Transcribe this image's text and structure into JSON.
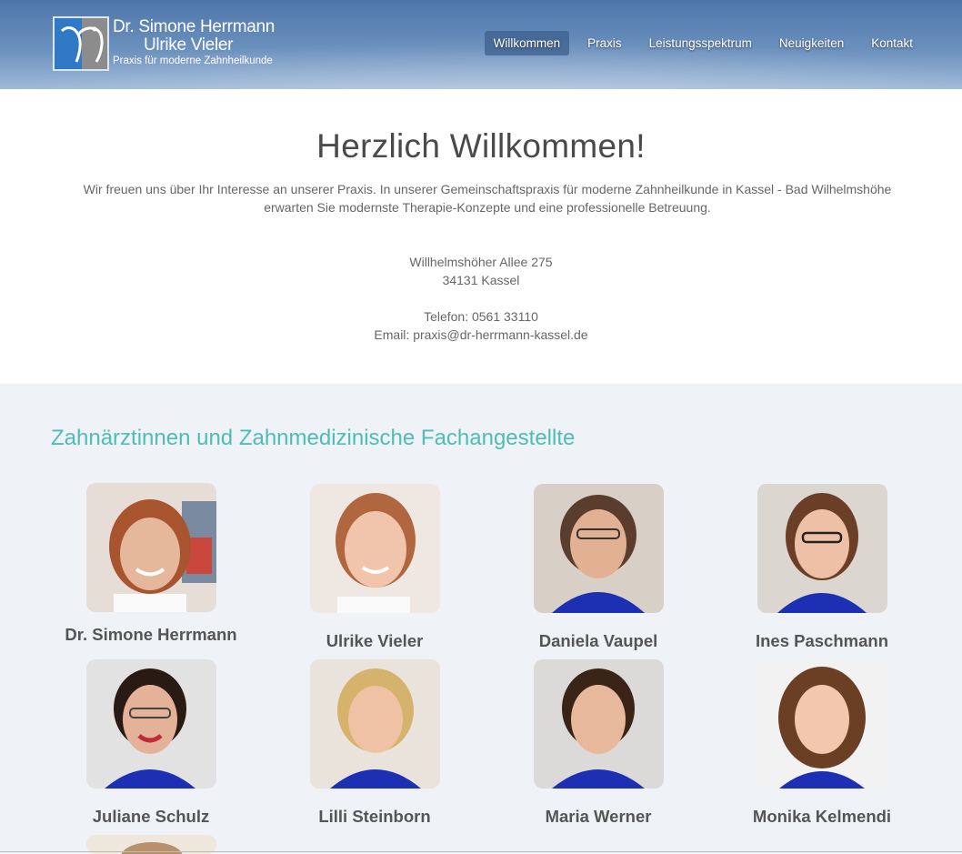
{
  "brand": {
    "line1": "Dr. Simone Herrmann",
    "line2": "Ulrike Vieler",
    "tagline": "Praxis für moderne Zahnheilkunde",
    "colors": {
      "accent": "#4fbcb6",
      "header": "#5b82b2"
    }
  },
  "nav": {
    "items": [
      {
        "label": "Willkommen"
      },
      {
        "label": "Praxis"
      },
      {
        "label": "Leistungsspektrum"
      },
      {
        "label": "Neuigkeiten"
      },
      {
        "label": "Kontakt"
      }
    ]
  },
  "welcome": {
    "title": "Herzlich Willkommen!",
    "intro": "Wir freuen uns über Ihr Interesse an unserer Praxis. In unserer Gemeinschaftspraxis für moderne Zahnheilkunde in Kassel - Bad Wilhelmshöhe erwarten Sie modernste Therapie-Konzepte und eine professionelle Betreuung.",
    "street": "Willhelmshöher Allee 275",
    "city": "34131 Kassel",
    "phone": "Telefon: 0561 33110",
    "email": "Email: praxis@dr-herrmann-kassel.de"
  },
  "team": {
    "title": "Zahnärztinnen und Zahnmedizinische Fachangestellte",
    "members": [
      {
        "name": "Dr. Simone Herrmann"
      },
      {
        "name": "Ulrike Vieler"
      },
      {
        "name": "Daniela Vaupel"
      },
      {
        "name": "Ines Paschmann"
      },
      {
        "name": "Juliane Schulz"
      },
      {
        "name": "Lilli Steinborn"
      },
      {
        "name": "Maria Werner"
      },
      {
        "name": "Monika Kelmendi"
      }
    ]
  }
}
